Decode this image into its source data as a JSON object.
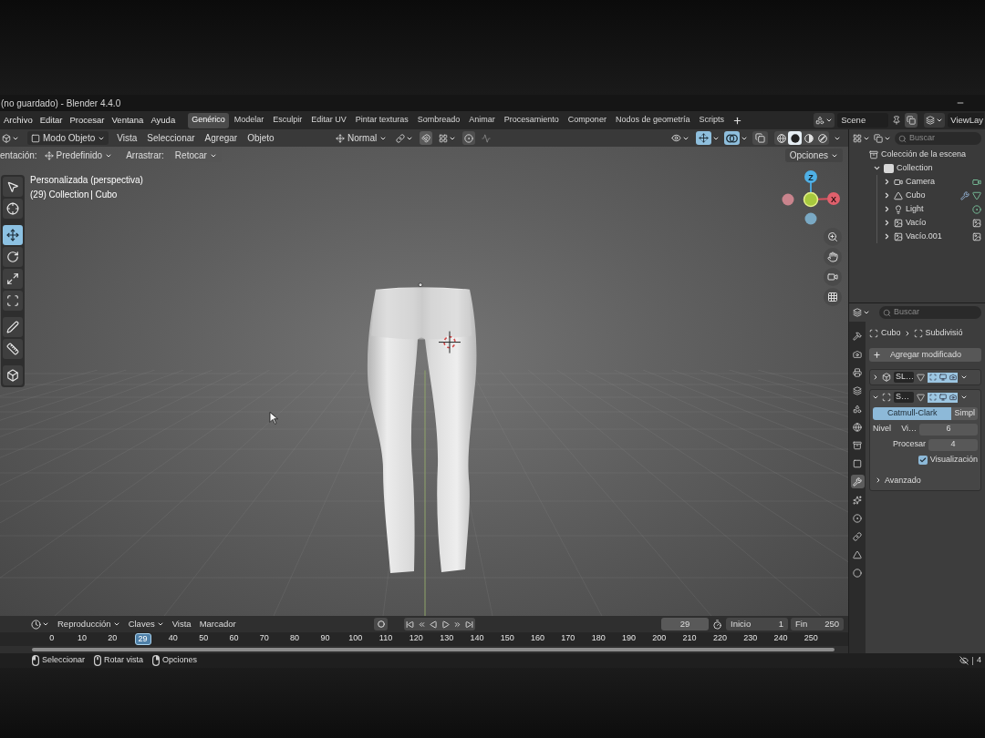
{
  "window": {
    "title": "(no guardado) - Blender 4.4.0"
  },
  "menu": [
    "Archivo",
    "Editar",
    "Procesar",
    "Ventana",
    "Ayuda"
  ],
  "workspaces": [
    {
      "label": "Genérico",
      "selected": true
    },
    {
      "label": "Modelar",
      "selected": false
    },
    {
      "label": "Esculpir",
      "selected": false
    },
    {
      "label": "Editar UV",
      "selected": false
    },
    {
      "label": "Pintar texturas",
      "selected": false
    },
    {
      "label": "Sombreado",
      "selected": false
    },
    {
      "label": "Animar",
      "selected": false
    },
    {
      "label": "Procesamiento",
      "selected": false
    },
    {
      "label": "Componer",
      "selected": false
    },
    {
      "label": "Nodos de geometría",
      "selected": false
    },
    {
      "label": "Scripts",
      "selected": false
    }
  ],
  "scene": {
    "name": "Scene"
  },
  "view_layer": {
    "name": "ViewLay"
  },
  "viewport_header": {
    "mode": "Modo Objeto",
    "menus": [
      "Vista",
      "Seleccionar",
      "Agregar",
      "Objeto"
    ],
    "orientation": "Normal",
    "toggles": [
      {
        "kind": "gizmo",
        "on": true
      },
      {
        "kind": "overlay",
        "on": true
      },
      {
        "kind": "xray",
        "on": false
      }
    ],
    "shading": [
      {
        "kind": "wireframe",
        "selected": false
      },
      {
        "kind": "solid",
        "selected": true
      },
      {
        "kind": "material",
        "selected": false
      },
      {
        "kind": "rendered",
        "selected": false
      }
    ]
  },
  "tool_settings": {
    "orientation_label": "entación:",
    "orientation": "Predefinido",
    "drag_label": "Arrastrar:",
    "drag": "Retocar",
    "options": "Opciones"
  },
  "viewport": {
    "view_name": "Personalizada (perspectiva)",
    "collection": "(29) Collection",
    "object": "Cubo",
    "gizmo": {
      "z_label": "Z",
      "x_label": "X"
    }
  },
  "tools": [
    {
      "kind": "select",
      "selected": false
    },
    {
      "kind": "cursor",
      "selected": false
    },
    {
      "kind": "move",
      "selected": true
    },
    {
      "kind": "rotate",
      "selected": false
    },
    {
      "kind": "scale",
      "selected": false
    },
    {
      "kind": "transform",
      "selected": false
    },
    {
      "kind": "annotate",
      "selected": false
    },
    {
      "kind": "measure",
      "selected": false
    },
    {
      "kind": "add_cube",
      "selected": false
    }
  ],
  "outliner": {
    "search_placeholder": "Buscar",
    "root": "Colección de la escena",
    "collections": [
      {
        "name": "Collection",
        "expanded": true,
        "children": [
          {
            "name": "Camera",
            "kind": "camera",
            "expanded": false
          },
          {
            "name": "Cubo",
            "kind": "mesh",
            "expanded": false
          },
          {
            "name": "Light",
            "kind": "light",
            "expanded": false
          },
          {
            "name": "Vacío",
            "kind": "empty_image",
            "expanded": false
          },
          {
            "name": "Vacío.001",
            "kind": "empty_image",
            "expanded": false
          }
        ]
      }
    ]
  },
  "properties": {
    "search_placeholder": "Buscar",
    "tabs": [
      {
        "kind": "tool",
        "selected": false
      },
      {
        "kind": "render",
        "selected": false
      },
      {
        "kind": "output",
        "selected": false
      },
      {
        "kind": "view_layer",
        "selected": false
      },
      {
        "kind": "scene",
        "selected": false
      },
      {
        "kind": "world",
        "selected": false
      },
      {
        "kind": "collection",
        "selected": false
      },
      {
        "kind": "object",
        "selected": false
      },
      {
        "kind": "modifiers",
        "selected": true
      },
      {
        "kind": "particles",
        "selected": false
      },
      {
        "kind": "physics",
        "selected": false
      },
      {
        "kind": "constraints",
        "selected": false
      },
      {
        "kind": "data",
        "selected": false
      },
      {
        "kind": "material",
        "selected": false
      }
    ],
    "breadcrumb": {
      "object": "Cubo",
      "modifier": "Subdivisió"
    },
    "add_modifier": "Agregar modificado",
    "modifiers": [
      {
        "name": "SL…",
        "kind": "solidify",
        "expanded": false
      },
      {
        "name": "S…",
        "kind": "subdivision",
        "expanded": true
      }
    ],
    "subdivision": {
      "types": [
        {
          "label": "Catmull-Clark",
          "selected": true
        },
        {
          "label": "Simpl",
          "selected": false
        }
      ],
      "levels": [
        {
          "label": "Nivel",
          "sublabel": "Vi…",
          "value": "6"
        },
        {
          "label": "Procesar",
          "value": "4"
        }
      ],
      "optimal_display": {
        "label": "Visualización",
        "checked": true
      },
      "advanced": {
        "label": "Avanzado",
        "expanded": false
      }
    }
  },
  "timeline": {
    "menus": [
      {
        "label": "Reproducción",
        "dropdown": true
      },
      {
        "label": "Claves",
        "dropdown": true
      },
      {
        "label": "Vista",
        "dropdown": false
      },
      {
        "label": "Marcador",
        "dropdown": false
      }
    ],
    "current_frame": "29",
    "start_label": "Inicio",
    "start": "1",
    "end_label": "Fin",
    "end": "250",
    "ruler": [
      {
        "label": "0",
        "selected": false
      },
      {
        "label": "10",
        "selected": false
      },
      {
        "label": "20",
        "selected": false
      },
      {
        "label": "29",
        "selected": true
      },
      {
        "label": "40",
        "selected": false
      },
      {
        "label": "50",
        "selected": false
      },
      {
        "label": "60",
        "selected": false
      },
      {
        "label": "70",
        "selected": false
      },
      {
        "label": "80",
        "selected": false
      },
      {
        "label": "90",
        "selected": false
      },
      {
        "label": "100",
        "selected": false
      },
      {
        "label": "110",
        "selected": false
      },
      {
        "label": "120",
        "selected": false
      },
      {
        "label": "130",
        "selected": false
      },
      {
        "label": "140",
        "selected": false
      },
      {
        "label": "150",
        "selected": false
      },
      {
        "label": "160",
        "selected": false
      },
      {
        "label": "170",
        "selected": false
      },
      {
        "label": "180",
        "selected": false
      },
      {
        "label": "190",
        "selected": false
      },
      {
        "label": "200",
        "selected": false
      },
      {
        "label": "210",
        "selected": false
      },
      {
        "label": "220",
        "selected": false
      },
      {
        "label": "230",
        "selected": false
      },
      {
        "label": "240",
        "selected": false
      },
      {
        "label": "250",
        "selected": false
      }
    ]
  },
  "status_bar": {
    "hints": [
      {
        "kind": "left_click",
        "label": "Seleccionar"
      },
      {
        "kind": "middle_click",
        "label": "Rotar vista"
      },
      {
        "kind": "right_click",
        "label": "Opciones"
      }
    ],
    "version": "4"
  }
}
